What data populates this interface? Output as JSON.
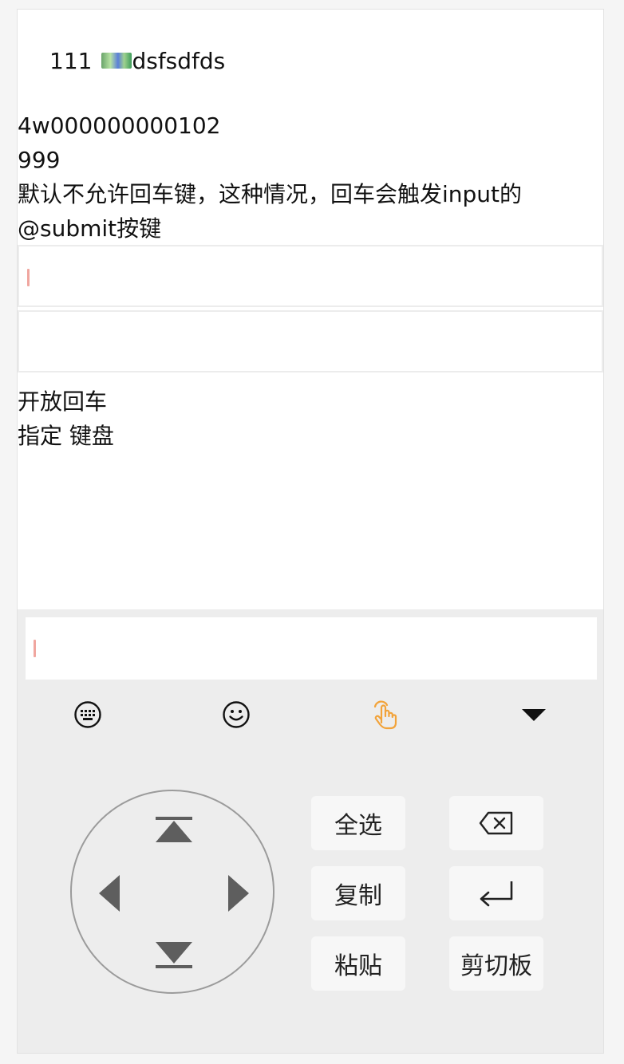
{
  "content": {
    "top_line_prefix": "111",
    "top_line_suffix": "dsfsdfds",
    "line1": "4w000000000102",
    "line2": "999",
    "line3": "默认不允许回车键，这种情况，回车会触发input的",
    "line4": "@submit按键",
    "line5": "开放回车",
    "line6": "指定 键盘"
  },
  "inputs": {
    "first_value": "",
    "second_value": "",
    "keyboard_input_value": ""
  },
  "keyboard": {
    "toolbar": [
      "keyboard-icon",
      "emoji-icon",
      "touch-icon",
      "collapse-triangle-icon"
    ],
    "active_tool_color": "#f2a33a",
    "keys": {
      "select_all": "全选",
      "copy": "复制",
      "paste": "粘贴",
      "clipboard": "剪切板"
    },
    "dpad": [
      "up-top-icon",
      "left-icon",
      "right-icon",
      "down-bottom-icon"
    ]
  }
}
